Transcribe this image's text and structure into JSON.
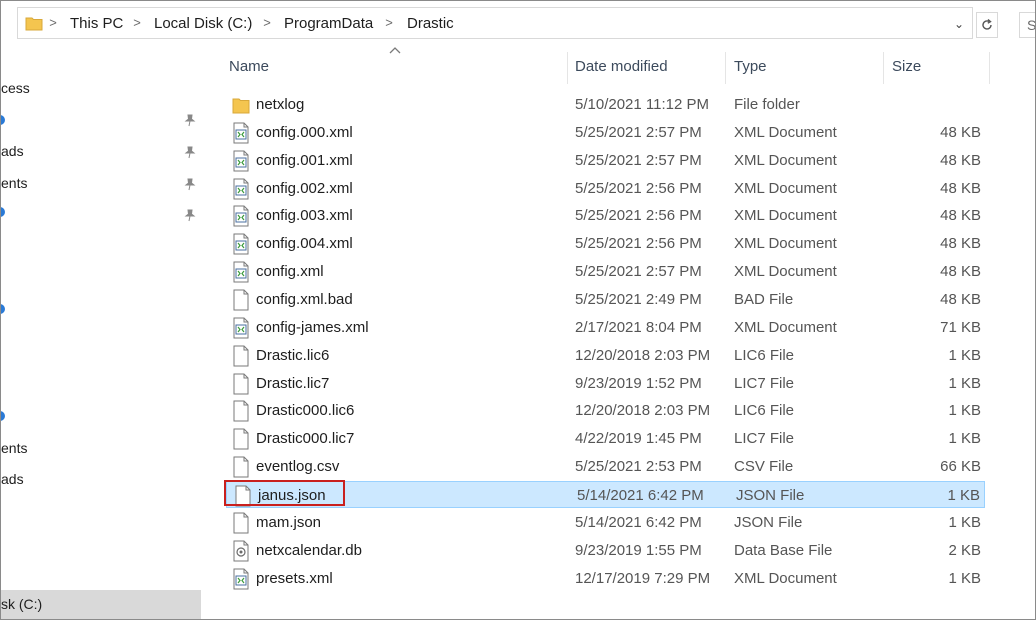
{
  "address_bar": {
    "crumbs": [
      "This PC",
      "Local Disk (C:)",
      "ProgramData",
      "Drastic"
    ],
    "search_text": "S"
  },
  "nav_pane": {
    "items": [
      {
        "label": "cess"
      },
      {
        "label": "ads"
      },
      {
        "label": "ents"
      },
      {
        "label": "ents"
      },
      {
        "label": "ads"
      }
    ],
    "selected": "sk (C:)"
  },
  "columns": {
    "name": "Name",
    "date": "Date modified",
    "type": "Type",
    "size": "Size"
  },
  "files": [
    {
      "name": "netxlog",
      "date": "5/10/2021 11:12 PM",
      "type": "File folder",
      "size": "",
      "icon": "folder-icon"
    },
    {
      "name": "config.000.xml",
      "date": "5/25/2021 2:57 PM",
      "type": "XML Document",
      "size": "48 KB",
      "icon": "xml-document-icon"
    },
    {
      "name": "config.001.xml",
      "date": "5/25/2021 2:57 PM",
      "type": "XML Document",
      "size": "48 KB",
      "icon": "xml-document-icon"
    },
    {
      "name": "config.002.xml",
      "date": "5/25/2021 2:56 PM",
      "type": "XML Document",
      "size": "48 KB",
      "icon": "xml-document-icon"
    },
    {
      "name": "config.003.xml",
      "date": "5/25/2021 2:56 PM",
      "type": "XML Document",
      "size": "48 KB",
      "icon": "xml-document-icon"
    },
    {
      "name": "config.004.xml",
      "date": "5/25/2021 2:56 PM",
      "type": "XML Document",
      "size": "48 KB",
      "icon": "xml-document-icon"
    },
    {
      "name": "config.xml",
      "date": "5/25/2021 2:57 PM",
      "type": "XML Document",
      "size": "48 KB",
      "icon": "xml-document-icon"
    },
    {
      "name": "config.xml.bad",
      "date": "5/25/2021 2:49 PM",
      "type": "BAD File",
      "size": "48 KB",
      "icon": "blank-file-icon"
    },
    {
      "name": "config-james.xml",
      "date": "2/17/2021 8:04 PM",
      "type": "XML Document",
      "size": "71 KB",
      "icon": "xml-document-icon"
    },
    {
      "name": "Drastic.lic6",
      "date": "12/20/2018 2:03 PM",
      "type": "LIC6 File",
      "size": "1 KB",
      "icon": "blank-file-icon"
    },
    {
      "name": "Drastic.lic7",
      "date": "9/23/2019 1:52 PM",
      "type": "LIC7 File",
      "size": "1 KB",
      "icon": "blank-file-icon"
    },
    {
      "name": "Drastic000.lic6",
      "date": "12/20/2018 2:03 PM",
      "type": "LIC6 File",
      "size": "1 KB",
      "icon": "blank-file-icon"
    },
    {
      "name": "Drastic000.lic7",
      "date": "4/22/2019 1:45 PM",
      "type": "LIC7 File",
      "size": "1 KB",
      "icon": "blank-file-icon"
    },
    {
      "name": "eventlog.csv",
      "date": "5/25/2021 2:53 PM",
      "type": "CSV File",
      "size": "66 KB",
      "icon": "blank-file-icon"
    },
    {
      "name": "janus.json",
      "date": "5/14/2021 6:42 PM",
      "type": "JSON File",
      "size": "1 KB",
      "icon": "blank-file-icon"
    },
    {
      "name": "mam.json",
      "date": "5/14/2021 6:42 PM",
      "type": "JSON File",
      "size": "1 KB",
      "icon": "blank-file-icon"
    },
    {
      "name": "netxcalendar.db",
      "date": "9/23/2019 1:55 PM",
      "type": "Data Base File",
      "size": "2 KB",
      "icon": "database-file-icon"
    },
    {
      "name": "presets.xml",
      "date": "12/17/2019 7:29 PM",
      "type": "XML Document",
      "size": "1 KB",
      "icon": "xml-document-icon"
    }
  ],
  "selected_file": "janus.json",
  "colors": {
    "selection_fill": "#cce8ff",
    "selection_border": "#99d1ff",
    "highlight_box": "#c9201e",
    "folder": "#f4c54f"
  }
}
